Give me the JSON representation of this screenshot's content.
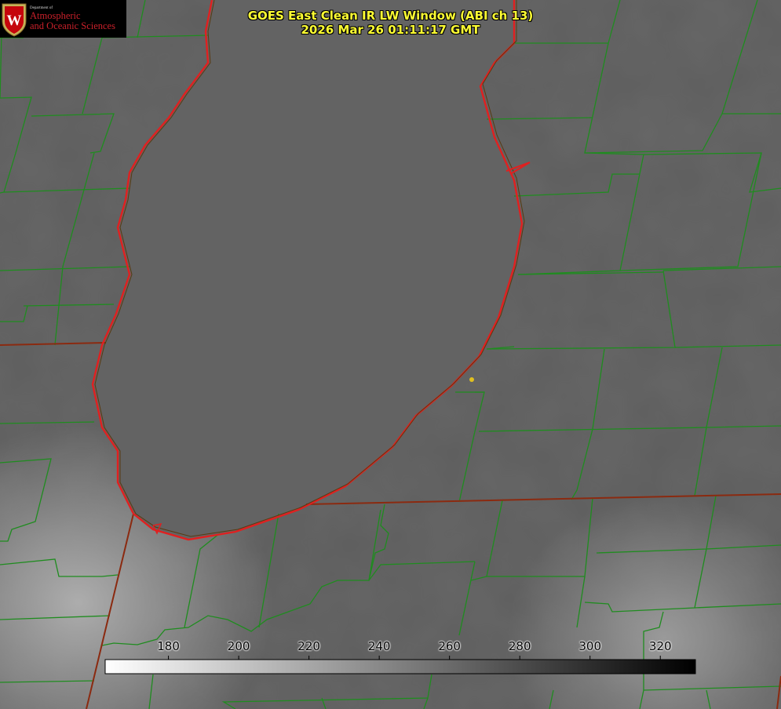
{
  "title": {
    "line1": "GOES East Clean IR LW Window (ABI ch 13)",
    "line2": "2026 Mar 26 01:11:17 GMT"
  },
  "logo": {
    "department": "Department of",
    "line1": "Atmospheric",
    "line2": "and Oceanic Sciences",
    "crest_letter": "W"
  },
  "colorbar": {
    "min": 162,
    "max": 330,
    "ticks": [
      "180",
      "200",
      "220",
      "240",
      "260",
      "280",
      "300",
      "320"
    ],
    "gradient_start": "#ffffff",
    "gradient_end": "#000000"
  },
  "colors": {
    "county_lines": "#1f8c1f",
    "coastline": "#e02020",
    "marker": "#e0c020",
    "title": "#ffff33",
    "logo_red": "#c9202a"
  }
}
